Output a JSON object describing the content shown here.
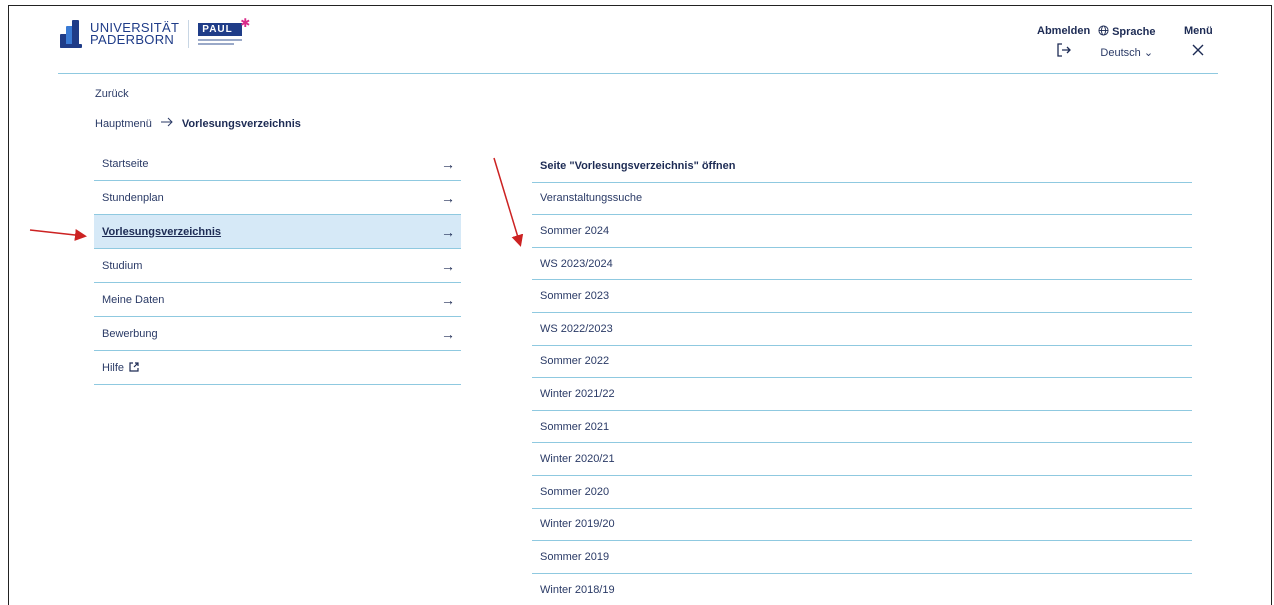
{
  "logo": {
    "university_line1": "UNIVERSITÄT",
    "university_line2": "PADERBORN",
    "paul": "PAUL"
  },
  "header": {
    "logout": {
      "label": "Abmelden",
      "icon": "logout-icon"
    },
    "language": {
      "label": "Sprache",
      "icon": "globe-icon",
      "value": "Deutsch"
    },
    "menu": {
      "label": "Menü",
      "icon": "close-icon"
    }
  },
  "nav": {
    "back": "Zurück",
    "breadcrumb": {
      "home": "Hauptmenü",
      "current": "Vorlesungsverzeichnis"
    }
  },
  "left_menu": [
    {
      "label": "Startseite",
      "arrow": true
    },
    {
      "label": "Stundenplan",
      "arrow": true
    },
    {
      "label": "Vorlesungsverzeichnis",
      "arrow": true,
      "active": true
    },
    {
      "label": "Studium",
      "arrow": true
    },
    {
      "label": "Meine Daten",
      "arrow": true
    },
    {
      "label": "Bewerbung",
      "arrow": true
    },
    {
      "label": "Hilfe",
      "arrow": false,
      "external": true
    }
  ],
  "right_list": [
    "Seite \"Vorlesungsverzeichnis\" öffnen",
    "Veranstaltungssuche",
    "Sommer 2024",
    "WS 2023/2024",
    "Sommer 2023",
    "WS 2022/2023",
    "Sommer 2022",
    "Winter 2021/22",
    "Sommer 2021",
    "Winter 2020/21",
    "Sommer 2020",
    "Winter 2019/20",
    "Sommer 2019",
    "Winter 2018/19"
  ],
  "colors": {
    "primary": "#1d2b54",
    "accent_line": "#8fc9e0",
    "active_bg": "#d6e9f7",
    "annotation": "#cc2222"
  }
}
